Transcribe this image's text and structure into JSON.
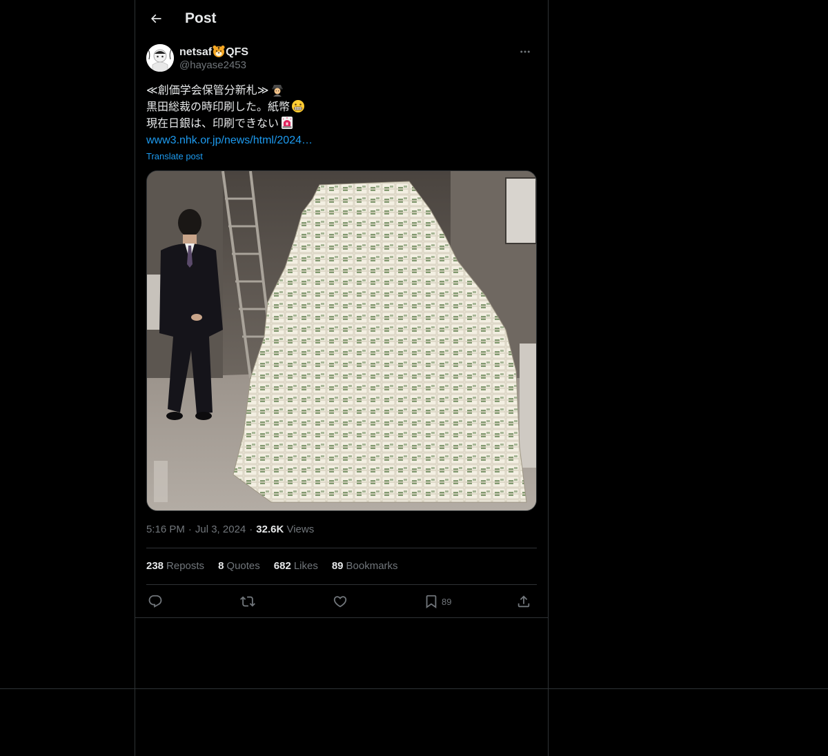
{
  "header": {
    "title": "Post",
    "back_icon": "arrow-left-icon"
  },
  "author": {
    "display_name": "netsaf",
    "display_name_suffix": "QFS",
    "name_emoji": "tiger-face-emoji",
    "handle": "@hayase2453",
    "more_icon": "more-horizontal-icon"
  },
  "post": {
    "lines": [
      {
        "text": "≪創価学会保管分新札≫",
        "emoji": "detective-emoji"
      },
      {
        "text": "黒田総裁の時印刷した。紙幣",
        "emoji": "grimacing-face-emoji"
      },
      {
        "text": "現在日銀は、印刷できない",
        "emoji": "police-light-emoji"
      }
    ],
    "link": "www3.nhk.or.jp/news/html/2024…",
    "translate_label": "Translate post",
    "media_description": "photo"
  },
  "meta": {
    "time": "5:16 PM",
    "dot": "·",
    "date": "Jul 3, 2024",
    "views_count": "32.6K",
    "views_label": "Views"
  },
  "stats": [
    {
      "count": "238",
      "label": "Reposts"
    },
    {
      "count": "8",
      "label": "Quotes"
    },
    {
      "count": "682",
      "label": "Likes"
    },
    {
      "count": "89",
      "label": "Bookmarks"
    }
  ],
  "actions": {
    "reply_icon": "reply-icon",
    "repost_icon": "repost-icon",
    "like_icon": "heart-icon",
    "bookmark_icon": "bookmark-icon",
    "bookmark_count": "89",
    "share_icon": "share-icon"
  },
  "colors": {
    "background": "#000000",
    "border": "#2f3336",
    "text_primary": "#e7e9ea",
    "text_secondary": "#71767b",
    "link": "#1d9bf0"
  }
}
